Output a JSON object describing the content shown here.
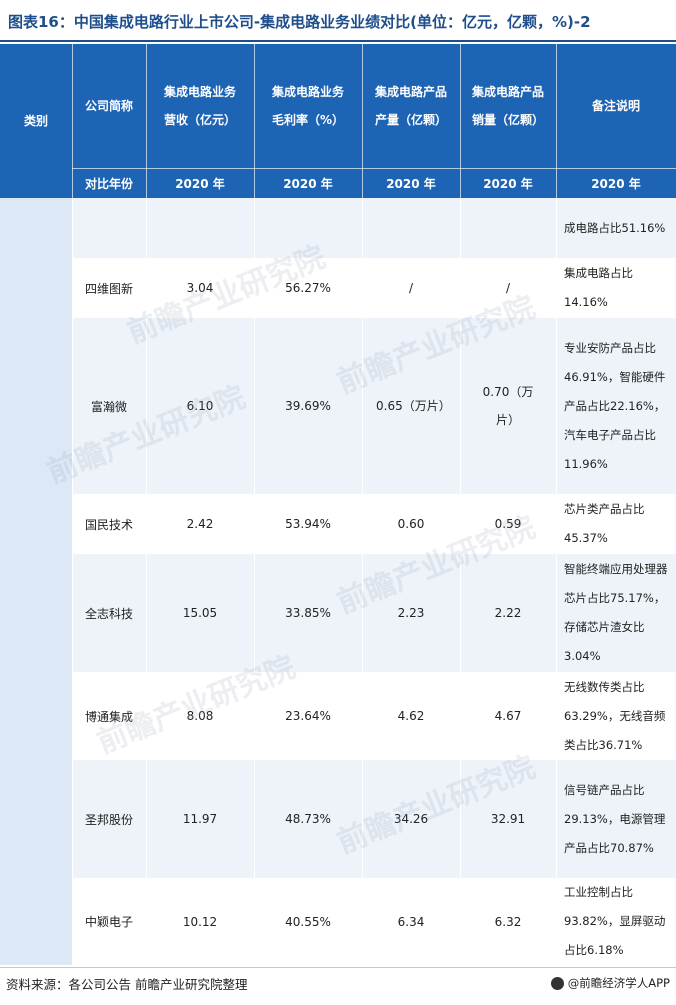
{
  "title": "图表16：中国集成电路行业上市公司-集成电路业务业绩对比(单位：亿元，亿颗，%)-2",
  "header": {
    "category": "类别",
    "company": "公司简称",
    "compare_year_label": "对比年份",
    "revenue": "集成电路业务营收（亿元）",
    "margin": "集成电路业务毛利率（%）",
    "output": "集成电路产品产量（亿颗）",
    "sales": "集成电路产品销量（亿颗）",
    "notes": "备注说明",
    "year": "2020 年"
  },
  "rows": [
    {
      "company": "",
      "revenue": "",
      "margin": "",
      "output": "",
      "sales": "",
      "note": "成电路占比51.16%"
    },
    {
      "company": "四维图新",
      "revenue": "3.04",
      "margin": "56.27%",
      "output": "/",
      "sales": "/",
      "note": "集成电路占比14.16%"
    },
    {
      "company": "富瀚微",
      "revenue": "6.10",
      "margin": "39.69%",
      "output": "0.65（万片）",
      "sales": "0.70（万片）",
      "note": "专业安防产品占比46.91%，智能硬件产品占比22.16%，汽车电子产品占比11.96%"
    },
    {
      "company": "国民技术",
      "revenue": "2.42",
      "margin": "53.94%",
      "output": "0.60",
      "sales": "0.59",
      "note": "芯片类产品占比45.37%"
    },
    {
      "company": "全志科技",
      "revenue": "15.05",
      "margin": "33.85%",
      "output": "2.23",
      "sales": "2.22",
      "note": "智能终端应用处理器芯片占比75.17%，存储芯片渣女比3.04%"
    },
    {
      "company": "博通集成",
      "revenue": "8.08",
      "margin": "23.64%",
      "output": "4.62",
      "sales": "4.67",
      "note": "无线数传类占比63.29%，无线音频类占比36.71%"
    },
    {
      "company": "圣邦股份",
      "revenue": "11.97",
      "margin": "48.73%",
      "output": "34.26",
      "sales": "32.91",
      "note": "信号链产品占比29.13%，电源管理产品占比70.87%"
    },
    {
      "company": "中颖电子",
      "revenue": "10.12",
      "margin": "40.55%",
      "output": "6.34",
      "sales": "6.32",
      "note": "工业控制占比93.82%，显屏驱动占比6.18%"
    }
  ],
  "footer": {
    "source": "资料来源：各公司公告 前瞻产业研究院整理",
    "brand": "@前瞻经济学人APP"
  },
  "watermark": "前瞻产业研究院",
  "colors": {
    "header_bg": "#1e64b4",
    "title": "#1f4e8c",
    "row_alt": "#eef3fa",
    "category_col": "#dde8f7"
  }
}
